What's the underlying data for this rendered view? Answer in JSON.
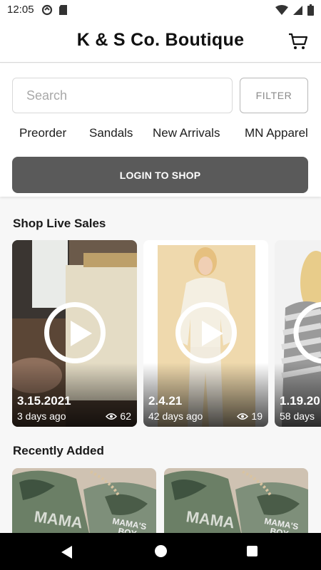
{
  "status_bar": {
    "time": "12:05",
    "icons": [
      "sync-icon",
      "sd-card-icon",
      "wifi-icon",
      "signal-icon",
      "battery-icon"
    ]
  },
  "header": {
    "title": "K & S Co. Boutique",
    "cart_icon": "cart-icon"
  },
  "search": {
    "placeholder": "Search",
    "value": ""
  },
  "filter": {
    "label": "FILTER"
  },
  "categories": [
    "Preorder",
    "Sandals",
    "New Arrivals",
    "MN Apparel"
  ],
  "login": {
    "label": "LOGIN TO SHOP"
  },
  "live_sales": {
    "title": "Shop Live Sales",
    "cards": [
      {
        "date": "3.15.2021",
        "ago": "3 days ago",
        "views": "62"
      },
      {
        "date": "2.4.21",
        "ago": "42 days ago",
        "views": "19"
      },
      {
        "date": "1.19.20",
        "ago": "58 days",
        "views": ""
      }
    ]
  },
  "recently_added": {
    "title": "Recently Added"
  },
  "colors": {
    "login_button": "#5a5a5a",
    "header_bg": "#ffffff",
    "page_bg": "#f7f7f7"
  }
}
